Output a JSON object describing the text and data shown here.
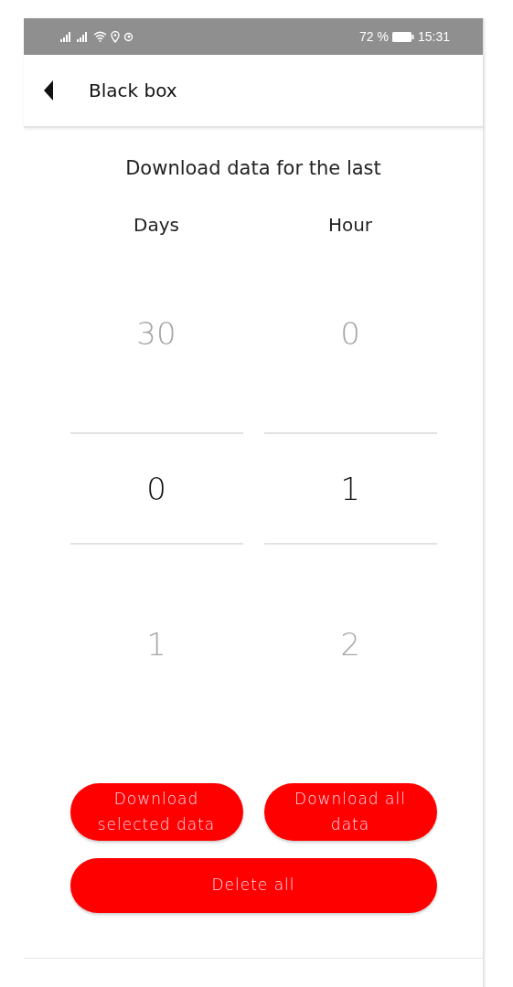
{
  "status_bar": {
    "battery": "72 %",
    "time": "15:31"
  },
  "header": {
    "title": "Black box"
  },
  "prompt": "Download data for the last",
  "pickers": [
    {
      "label": "Days",
      "items": [
        {
          "value": "30",
          "selected": false
        },
        {
          "value": "0",
          "selected": true
        },
        {
          "value": "1",
          "selected": false
        }
      ]
    },
    {
      "label": "Hour",
      "items": [
        {
          "value": "0",
          "selected": false
        },
        {
          "value": "1",
          "selected": true
        },
        {
          "value": "2",
          "selected": false
        }
      ]
    }
  ],
  "buttons": [
    {
      "label": "Download selected data",
      "kind": "half"
    },
    {
      "label": "Download all data",
      "kind": "half"
    },
    {
      "label": "Delete all",
      "kind": "full"
    }
  ]
}
